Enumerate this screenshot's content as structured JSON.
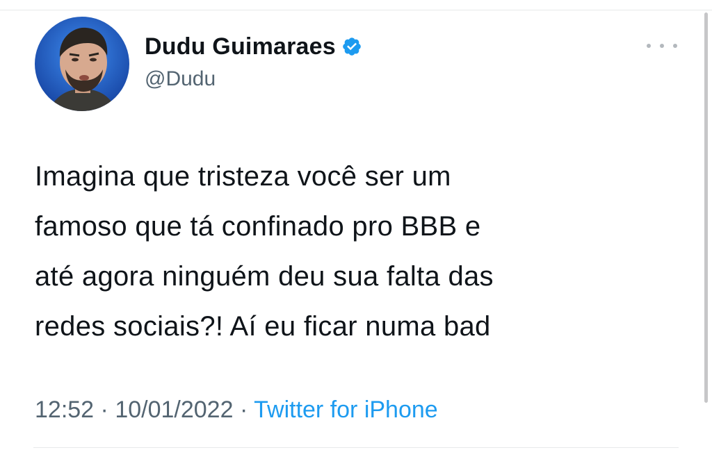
{
  "tweet": {
    "author": {
      "display_name": "Dudu Guimaraes",
      "handle": "@Dudu",
      "verified": true,
      "verified_icon": "verified-badge-icon",
      "verified_color": "#1d9bf0"
    },
    "more_icon": "more-options-icon",
    "text_lines": [
      "Imagina que tristeza você ser um",
      "famoso que tá confinado pro BBB e",
      "até agora ninguém deu sua falta das",
      "redes sociais?! Aí eu ficar numa bad"
    ],
    "time": "12:52",
    "separator": "·",
    "date": "10/01/2022",
    "source": "Twitter for iPhone"
  },
  "colors": {
    "text_primary": "#0f1419",
    "text_secondary": "#536471",
    "link": "#1d9bf0",
    "divider": "#e7e9ea"
  }
}
